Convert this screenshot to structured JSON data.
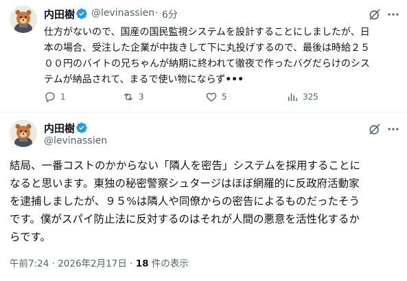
{
  "tweet1": {
    "display_name": "内田樹",
    "handle": "@levinassien",
    "separator": "·",
    "time": "6分",
    "text_lines": [
      "仕方がないので、国産の国民監視システムを設計することにしましたが、日",
      "本の場合、受注した企業が中抜きして下に丸投げするので、最後は時給２５",
      "００円のバイトの兄ちゃんが納期に終われて徹夜で作ったバグだらけのシス",
      "テムが納品されて、まるで使い物にならず"
    ],
    "show_more": "•••",
    "actions": {
      "reply_count": "1",
      "retweet_count": "3",
      "like_count": "5",
      "views_count": "325"
    }
  },
  "tweet2": {
    "display_name": "内田樹",
    "handle": "@levinassien",
    "text_lines": [
      "結局、一番コストのかからない「隣人を密告」システムを採用することに",
      "なると思います。東独の秘密警察シュタージはほぼ網羅的に反政府活動家",
      "を逮捕しましたが、９５%は隣人や同僚からの密告によるものだったそう",
      "です。僕がスパイ防止法に反対するのはそれが人間の悪意を活性化するか",
      "らです。"
    ],
    "meta": {
      "timestamp": "午前7:24 · 2026年2月17日 · ",
      "views_count": "18",
      "views_label": " 件の表示"
    }
  },
  "icons": {
    "verified": "verified-badge-icon",
    "grok": "grok-icon",
    "more": "more-dots-icon",
    "reply": "reply-icon",
    "retweet": "retweet-icon",
    "like": "like-icon",
    "views": "views-icon"
  },
  "colors": {
    "text": "#0f1419",
    "secondary": "#536471",
    "verified_blue": "#1d9bf0",
    "divider": "#eff3f4"
  }
}
